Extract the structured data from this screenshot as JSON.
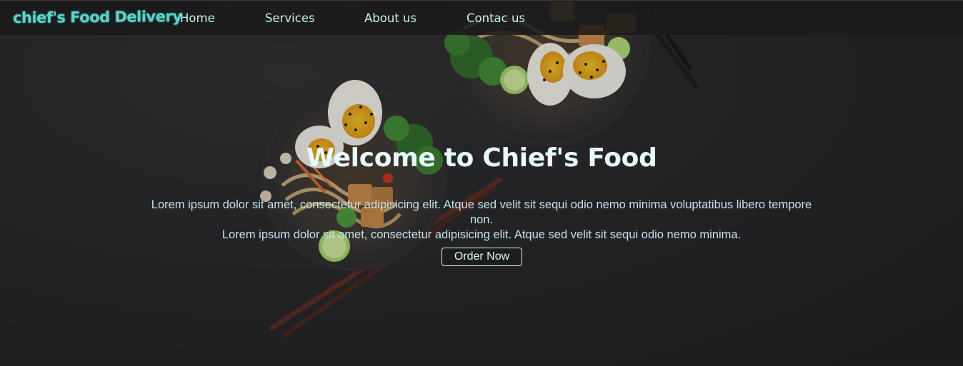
{
  "navbar": {
    "logo_text": "chief's Food Delivery",
    "links": [
      {
        "label": "Home"
      },
      {
        "label": "Services"
      },
      {
        "label": "About us"
      },
      {
        "label": "Contac us"
      }
    ]
  },
  "hero": {
    "headline": "Welcome to Chief's Food",
    "paragraph_1": "Lorem ipsum dolor sit amet, consectetur adipisicing elit. Atque sed velit sit sequi odio nemo minima voluptatibus libero tempore non.",
    "paragraph_2": "Lorem ipsum dolor sit amet, consectetur adipisicing elit. Atque sed velit sit sequi odio nemo minima.",
    "cta_label": "Order Now"
  },
  "colors": {
    "background": "#232325",
    "navbar": "#1a1a1b",
    "logo": "#5fd3c8",
    "nav_text": "#bff3ef",
    "headline": "#e6fbfa",
    "body_text": "#bfe3ea"
  },
  "icons": [
    "ramen-bowl-image",
    "chopsticks-image"
  ]
}
